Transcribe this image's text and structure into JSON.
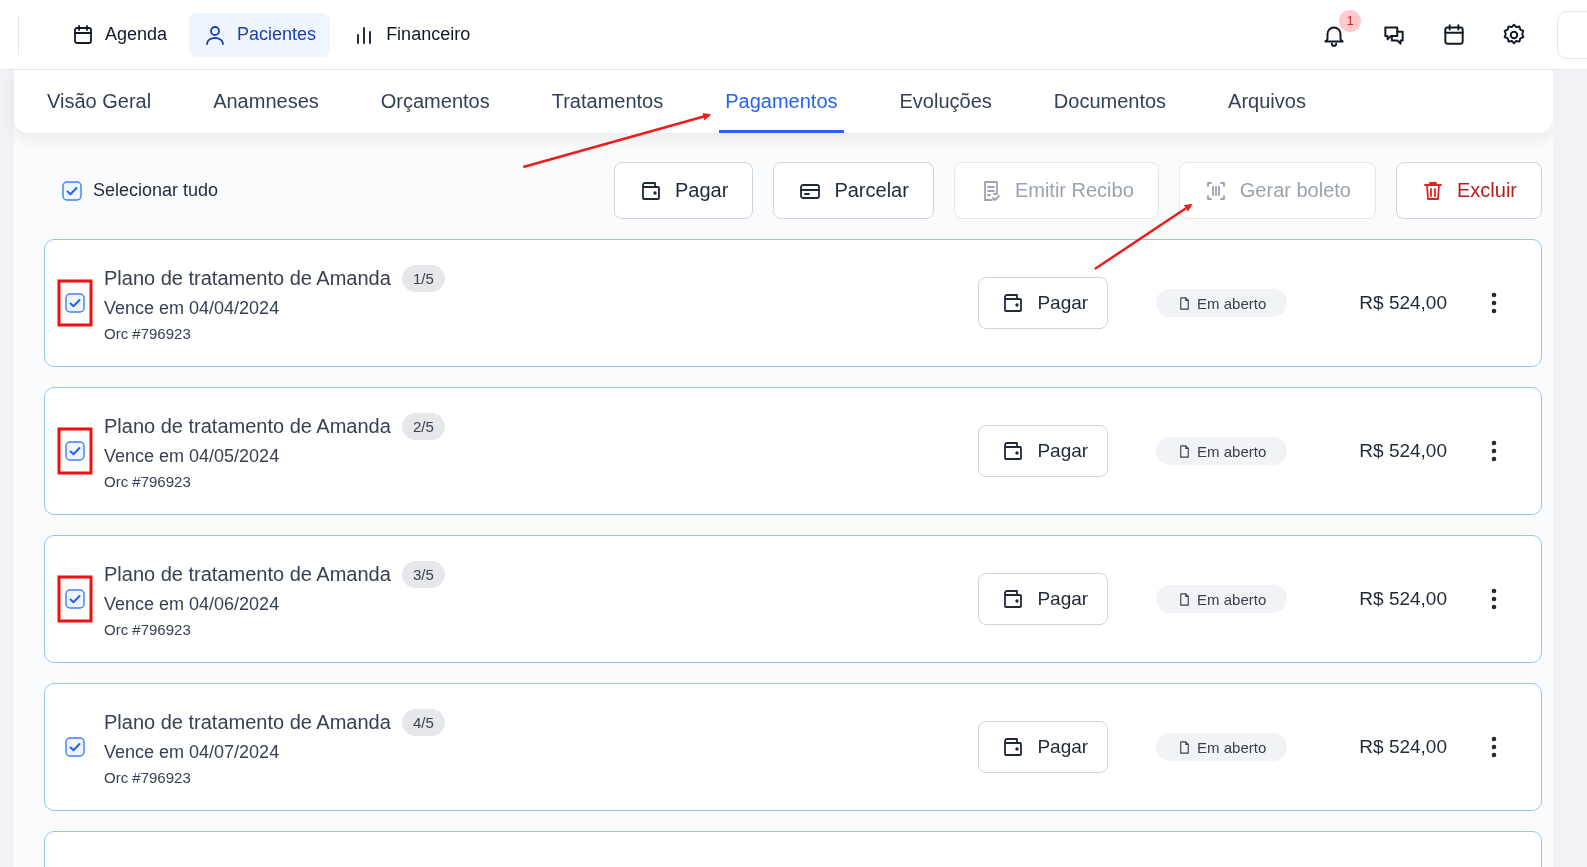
{
  "top_nav": {
    "items": [
      {
        "label": "Agenda",
        "selected": false
      },
      {
        "label": "Pacientes",
        "selected": true
      },
      {
        "label": "Financeiro",
        "selected": false
      }
    ],
    "notification_badge": "1"
  },
  "tabs": [
    {
      "label": "Visão Geral",
      "selected": false
    },
    {
      "label": "Anamneses",
      "selected": false
    },
    {
      "label": "Orçamentos",
      "selected": false
    },
    {
      "label": "Tratamentos",
      "selected": false
    },
    {
      "label": "Pagamentos",
      "selected": true
    },
    {
      "label": "Evoluções",
      "selected": false
    },
    {
      "label": "Documentos",
      "selected": false
    },
    {
      "label": "Arquivos",
      "selected": false
    }
  ],
  "select_all": {
    "label": "Selecionar tudo",
    "checked": true
  },
  "actions": [
    {
      "label": "Pagar",
      "kind": "normal",
      "disabled": false
    },
    {
      "label": "Parcelar",
      "kind": "normal",
      "disabled": false
    },
    {
      "label": "Emitir Recibo",
      "kind": "normal",
      "disabled": true
    },
    {
      "label": "Gerar boleto",
      "kind": "normal",
      "disabled": true
    },
    {
      "label": "Excluir",
      "kind": "danger",
      "disabled": false
    }
  ],
  "payments": [
    {
      "title": "Plano de tratamento de Amanda",
      "installment": "1/5",
      "due": "Vence em 04/04/2024",
      "ref": "Orc #796923",
      "checked": true,
      "highlighted": true,
      "pay_label": "Pagar",
      "status": "Em aberto",
      "amount": "R$ 524,00"
    },
    {
      "title": "Plano de tratamento de Amanda",
      "installment": "2/5",
      "due": "Vence em 04/05/2024",
      "ref": "Orc #796923",
      "checked": true,
      "highlighted": true,
      "pay_label": "Pagar",
      "status": "Em aberto",
      "amount": "R$ 524,00"
    },
    {
      "title": "Plano de tratamento de Amanda",
      "installment": "3/5",
      "due": "Vence em 04/06/2024",
      "ref": "Orc #796923",
      "checked": true,
      "highlighted": true,
      "pay_label": "Pagar",
      "status": "Em aberto",
      "amount": "R$ 524,00"
    },
    {
      "title": "Plano de tratamento de Amanda",
      "installment": "4/5",
      "due": "Vence em 04/07/2024",
      "ref": "Orc #796923",
      "checked": true,
      "highlighted": false,
      "pay_label": "Pagar",
      "status": "Em aberto",
      "amount": "R$ 524,00"
    }
  ],
  "more_below": true,
  "annotations": [
    {
      "kind": "arrow"
    },
    {
      "kind": "arrow"
    }
  ]
}
